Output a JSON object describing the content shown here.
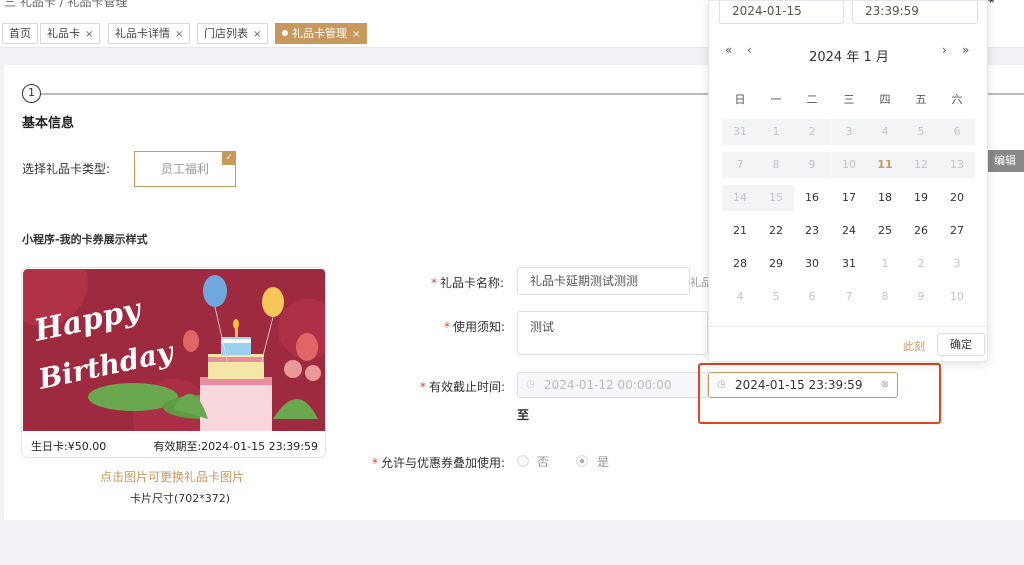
{
  "topbar": {
    "crumb": "三  礼品卡 / 礼品卡管理",
    "right_icon": "⇥"
  },
  "tabs": [
    {
      "label": "首页",
      "closable": false
    },
    {
      "label": "礼品卡",
      "closable": true
    },
    {
      "label": "礼品卡详情",
      "closable": true
    },
    {
      "label": "门店列表",
      "closable": true
    },
    {
      "label": "礼品卡管理",
      "closable": true,
      "active": true
    }
  ],
  "tab_close": "×",
  "step": {
    "number": "1",
    "title": "基本信息"
  },
  "card_type": {
    "label": "选择礼品卡类型:",
    "option": "员工福利",
    "check": "✓"
  },
  "edit_button": "编辑",
  "mini_program_label": "小程序-我的卡券展示样式",
  "card": {
    "art_text_1": "Happy",
    "art_text_2": "Birthday",
    "price_text": "生日卡:¥50.00",
    "expiry_text": "有效期至:2024-01-15 23:39:59",
    "change_image": "点击图片可更换礼品卡图片",
    "size": "卡片尺寸(702*372)"
  },
  "form": {
    "required_mark": "*",
    "name_label": "礼品卡名称:",
    "name_value": "礼品卡延期测试测测",
    "name_suffix": "礼品",
    "notice_label": "使用须知:",
    "notice_value": "测试",
    "expiry_label": "有效截止时间:",
    "expiry_old": "2024-01-12 00:00:00",
    "expiry_new": "2024-01-15 23:39:59",
    "expiry_to": "至",
    "stack_label": "允许与优惠券叠加使用:",
    "stack_no": "否",
    "stack_yes": "是"
  },
  "picker": {
    "date_input": "2024-01-15",
    "time_input": "23:39:59",
    "prev_year": "«",
    "prev_month": "‹",
    "next_month": "›",
    "next_year": "»",
    "title": "2024 年  1 月",
    "weekdays": [
      "日",
      "一",
      "二",
      "三",
      "四",
      "五",
      "六"
    ],
    "days": [
      [
        "31",
        "1",
        "2",
        "3",
        "4",
        "5",
        "6"
      ],
      [
        "7",
        "8",
        "9",
        "10",
        "11",
        "12",
        "13"
      ],
      [
        "14",
        "15",
        "16",
        "17",
        "18",
        "19",
        "20"
      ],
      [
        "21",
        "22",
        "23",
        "24",
        "25",
        "26",
        "27"
      ],
      [
        "28",
        "29",
        "30",
        "31",
        "1",
        "2",
        "3"
      ],
      [
        "4",
        "5",
        "6",
        "7",
        "8",
        "9",
        "10"
      ]
    ],
    "today": "11",
    "now_button": "此刻",
    "ok_button": "确定"
  },
  "colors": {
    "accent": "#c9985c",
    "highlight": "#e2451f",
    "card_bg": "#9e2a3f"
  }
}
